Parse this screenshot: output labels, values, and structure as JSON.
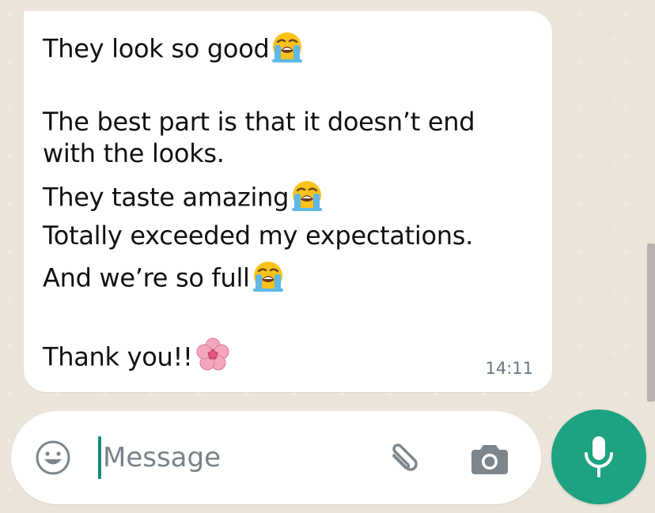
{
  "message": {
    "lines": [
      "They look so good",
      "The best part is that it doesn’t end",
      "with the looks.",
      "They taste amazing",
      "Totally exceeded my expectations.",
      "And we’re so full",
      "Thank you!!"
    ],
    "time": "14:11"
  },
  "composer": {
    "placeholder": "Message"
  },
  "icons": {
    "emoji": "smiley-icon",
    "attach": "paperclip-icon",
    "camera": "camera-icon",
    "mic": "microphone-icon",
    "crying": "loudly-crying-face-emoji",
    "blossom": "cherry-blossom-emoji"
  },
  "colors": {
    "accent": "#1da381",
    "caret": "#128c7e",
    "timestamp": "#667781",
    "background": "#ebe5dc"
  }
}
